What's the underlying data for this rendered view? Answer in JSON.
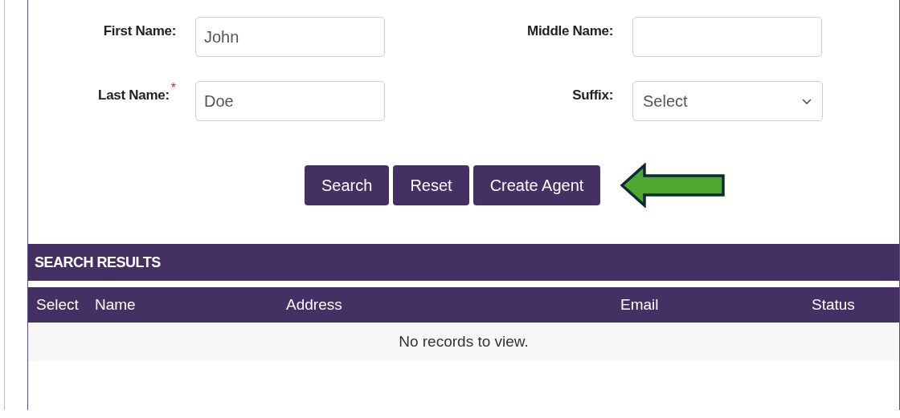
{
  "form": {
    "fields": [
      {
        "kind": "text",
        "label": "First Name:",
        "required": false,
        "value": "John"
      },
      {
        "kind": "text",
        "label": "Middle Name:",
        "required": false
      },
      {
        "kind": "text",
        "label": "Last Name:",
        "required": true,
        "required_mark": "*",
        "value": "Doe"
      },
      {
        "kind": "select",
        "label": "Suffix:",
        "required": false,
        "value": "Select"
      }
    ],
    "buttons": [
      "Search",
      "Reset",
      "Create Agent"
    ]
  },
  "results": {
    "title": "SEARCH RESULTS",
    "columns": [
      "Select",
      "Name",
      "Address",
      "Email",
      "Status"
    ],
    "empty_message": "No records to view."
  }
}
